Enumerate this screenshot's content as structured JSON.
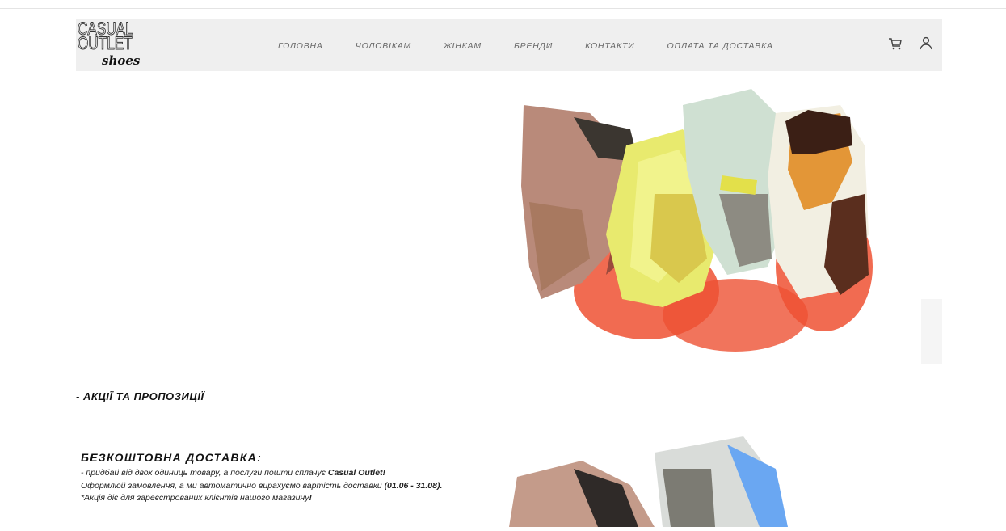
{
  "logo": {
    "line1": "CASUAL",
    "line2": "OUTLET",
    "line3": "shoes"
  },
  "nav": {
    "items": [
      {
        "label": "ГОЛОВНА"
      },
      {
        "label": "ЧОЛОВІКАМ"
      },
      {
        "label": "ЖІНКАМ"
      },
      {
        "label": "БРЕНДИ"
      },
      {
        "label": "КОНТАКТИ"
      },
      {
        "label": "ОПЛАТА ТА ДОСТАВКА"
      }
    ]
  },
  "header_icons": [
    "cart-icon",
    "user-icon"
  ],
  "promo": {
    "section_title": "- АКЦІЇ ТА ПРОПОЗИЦІЇ",
    "title": "БЕЗКОШТОВНА ДОСТАВКА:",
    "line1_prefix": "- придбай від двох одиниць товару, а послуги пошти сплачує ",
    "line1_brand": "Casual Outlet!",
    "line2_prefix": "Оформлюй замовлення, а ми автоматично вирахуємо вартість доставки ",
    "line2_dates": "(01.06 - 31.08).",
    "line3_prefix": "*Акція діє для зареєстрованих клієнтів нашого магазину",
    "line3_end": "!"
  },
  "colors": {
    "header_bg": "#efefef",
    "accent_red": "#e8462e",
    "shoe_yellow": "#e8e66a"
  }
}
